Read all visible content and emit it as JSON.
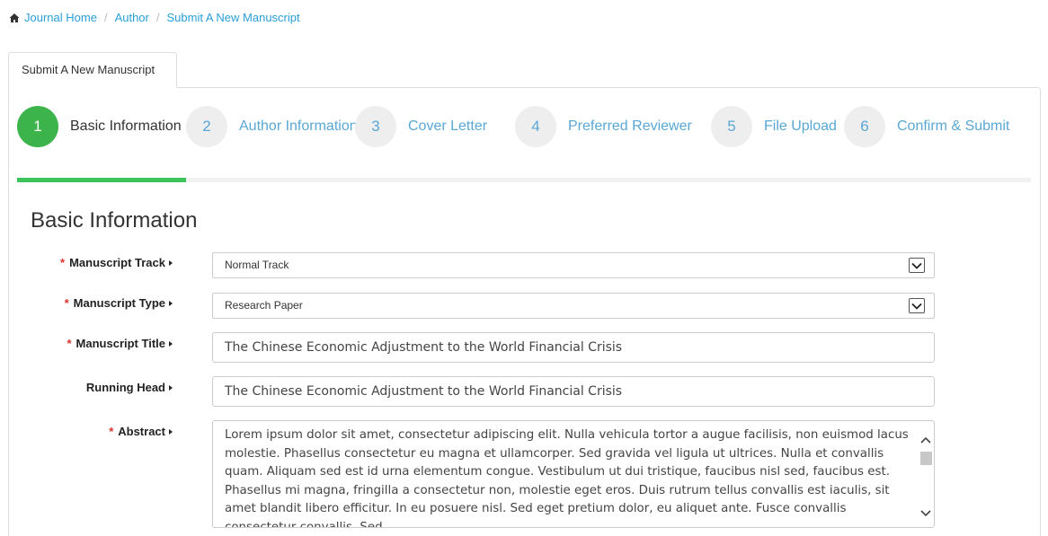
{
  "breadcrumb": {
    "home_icon": "home-icon",
    "items": [
      "Journal Home",
      "Author",
      "Submit A New Manuscript"
    ],
    "separator": "/"
  },
  "tab": {
    "label": "Submit A New Manuscript"
  },
  "wizard": {
    "steps": [
      {
        "number": "1",
        "label": "Basic Information",
        "active": true
      },
      {
        "number": "2",
        "label": "Author Information",
        "active": false
      },
      {
        "number": "3",
        "label": "Cover Letter",
        "active": false
      },
      {
        "number": "4",
        "label": "Preferred Reviewer",
        "active": false
      },
      {
        "number": "5",
        "label": "File Upload",
        "active": false
      },
      {
        "number": "6",
        "label": "Confirm & Submit",
        "active": false
      }
    ],
    "progress": 0.1667,
    "colors": {
      "active": "#3cb44b",
      "inactive_text": "#59a7d4",
      "progress": "#3cc35a"
    }
  },
  "section": {
    "title": "Basic Information"
  },
  "form": {
    "required_marker": "*",
    "manuscript_track": {
      "label": "Manuscript Track",
      "value": "Normal Track"
    },
    "manuscript_type": {
      "label": "Manuscript Type",
      "value": "Research Paper"
    },
    "manuscript_title": {
      "label": "Manuscript Title",
      "value": "The Chinese Economic Adjustment to the World Financial Crisis"
    },
    "running_head": {
      "label": "Running Head",
      "value": "The Chinese Economic Adjustment to the World Financial Crisis"
    },
    "abstract": {
      "label": "Abstract",
      "value": "Lorem ipsum dolor sit amet, consectetur adipiscing elit. Nulla vehicula tortor a augue facilisis, non euismod lacus molestie. Phasellus consectetur eu magna et ullamcorper. Sed gravida vel ligula ut ultrices. Nulla et convallis quam. Aliquam sed est id urna elementum congue. Vestibulum ut dui tristique, faucibus nisl sed, faucibus est. Phasellus mi magna, fringilla a consectetur non, molestie eget eros. Duis rutrum tellus convallis est iaculis, sit amet blandit libero efficitur. In eu posuere nisl. Sed eget pretium dolor, eu aliquet ante. Fusce convallis consectetur convallis. Sed"
    }
  }
}
